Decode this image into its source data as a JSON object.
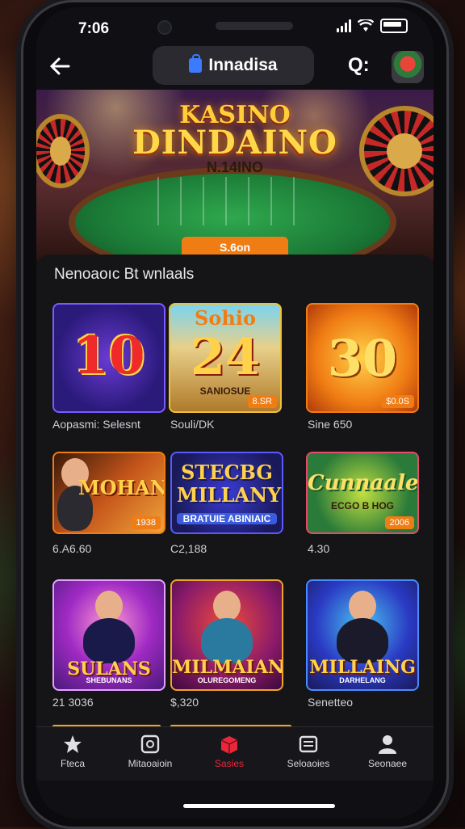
{
  "status": {
    "time": "7:06"
  },
  "nav": {
    "title": "Innadisa",
    "search_glyph": "Q:"
  },
  "hero": {
    "title_top": "KASINO",
    "title_main": "DINDAINO",
    "subtitle": "N.14INO",
    "cta": "S.6on"
  },
  "section": {
    "title": "Nenoaoıc Bt wnlaals"
  },
  "games": [
    {
      "big": "10",
      "label": "Aopasmi: Selesnt",
      "badge": ""
    },
    {
      "big": "24",
      "top": "Sohio",
      "sub": "SANIOSUE",
      "label": "Souli/DK",
      "badge": "8.SR"
    },
    {
      "big": "30",
      "label": "Sine 650",
      "badge": "$0.0S"
    },
    {
      "big": "MOHAN",
      "label": "6.A6.60",
      "badge": "1938"
    },
    {
      "big": "STECBG MILLANY",
      "sub": "BRATUIE ABINIAIC",
      "label": "C2,188",
      "badge": ""
    },
    {
      "big": "Cunnaale",
      "sub": "ECGO B HOG",
      "label": "4.30",
      "badge": "2006"
    },
    {
      "big": "SULANS",
      "sub": "SHEBUNANS",
      "label": "21 3036",
      "badge": ""
    },
    {
      "big": "MILMAIANG",
      "sub": "OLUREGOMENG",
      "label": "$,320",
      "badge": ""
    },
    {
      "big": "MILLAING",
      "sub": "DARHELANG",
      "label": "Senetteo",
      "badge": ""
    }
  ],
  "tabs": [
    {
      "label": "Fteca",
      "icon": "star-icon"
    },
    {
      "label": "Mitaoaioin",
      "icon": "square-icon"
    },
    {
      "label": "Sasies",
      "icon": "box-icon"
    },
    {
      "label": "Seloaoies",
      "icon": "list-icon"
    },
    {
      "label": "Seonaee",
      "icon": "user-icon"
    }
  ],
  "colors": {
    "accent": "#f07d14",
    "active_tab": "#e8283a",
    "panel": "#151518"
  }
}
